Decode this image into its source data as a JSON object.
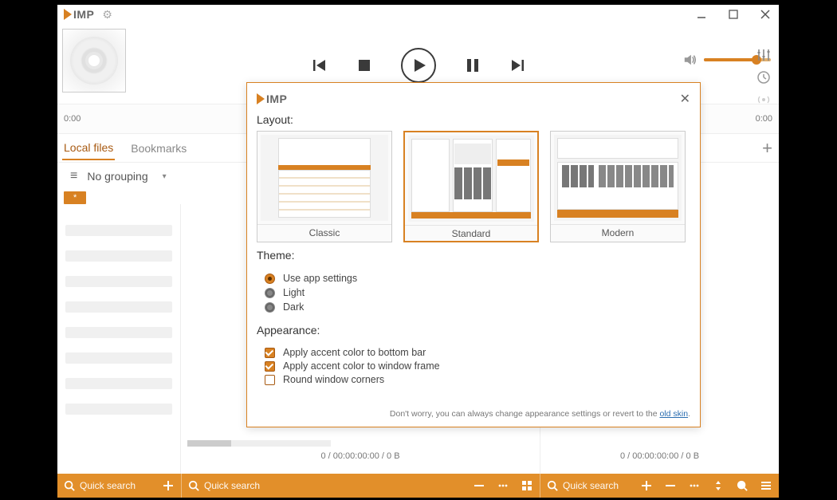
{
  "brand": {
    "name_imp": "IMP"
  },
  "titlebar": {},
  "player": {
    "time_left": "0:00",
    "time_right": "0:00"
  },
  "tabs": {
    "local": "Local files",
    "bookmarks": "Bookmarks"
  },
  "grouping": {
    "label": "No grouping"
  },
  "starchip": "*",
  "status": {
    "mid": "0 / 00:00:00:00 / 0 B",
    "right": "0 / 00:00:00:00 / 0 B"
  },
  "bottombar": {
    "search_placeholder": "Quick search"
  },
  "modal": {
    "layout_label": "Layout:",
    "layouts": {
      "classic": "Classic",
      "standard": "Standard",
      "modern": "Modern"
    },
    "theme_label": "Theme:",
    "themes": {
      "app": "Use app settings",
      "light": "Light",
      "dark": "Dark"
    },
    "appearance_label": "Appearance:",
    "appearance": {
      "accent_bottom": "Apply accent color to bottom bar",
      "accent_frame": "Apply accent color to window frame",
      "round_corners": "Round window corners"
    },
    "hint_pre": "Don't worry, you can always change appearance settings or revert to the ",
    "hint_link": "old skin",
    "hint_post": "."
  }
}
